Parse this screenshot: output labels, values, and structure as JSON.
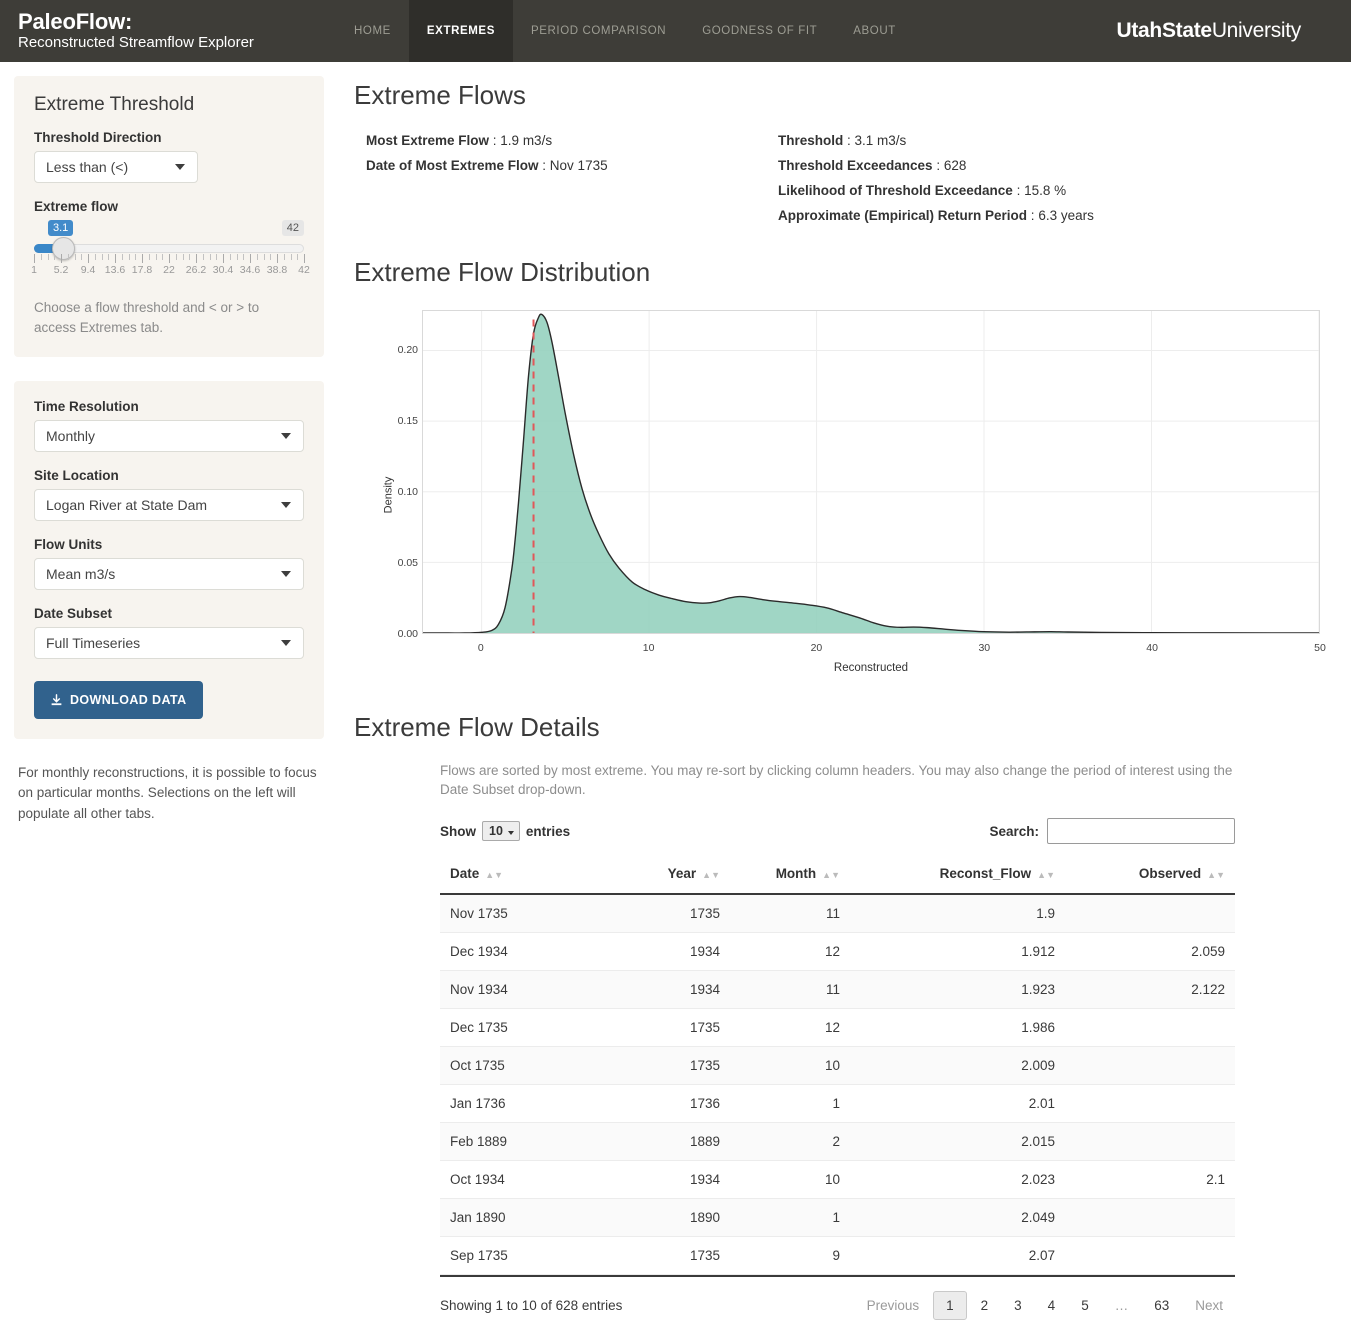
{
  "navbar": {
    "brand_title": "PaleoFlow:",
    "brand_subtitle": "Reconstructed Streamflow Explorer",
    "links": [
      {
        "label": "HOME",
        "active": false
      },
      {
        "label": "EXTREMES",
        "active": true
      },
      {
        "label": "PERIOD COMPARISON",
        "active": false
      },
      {
        "label": "GOODNESS OF FIT",
        "active": false
      },
      {
        "label": "ABOUT",
        "active": false
      }
    ],
    "org_bold": "UtahState",
    "org_light": "University",
    "bg_color": "#3e3d38",
    "active_bg_color": "#2f2e2a"
  },
  "sidebar": {
    "threshold_panel": {
      "title": "Extreme Threshold",
      "direction_label": "Threshold Direction",
      "direction_value": "Less than (<)",
      "slider_label": "Extreme flow",
      "slider_value": "3.1",
      "slider_max_label": "42",
      "slider_min": 1,
      "slider_max": 42,
      "tick_labels": [
        "1",
        "5.2",
        "9.4",
        "13.6",
        "17.8",
        "22",
        "26.2",
        "30.4",
        "34.6",
        "38.8",
        "42"
      ],
      "hint": "Choose a flow threshold and < or > to access Extremes tab.",
      "accent_color": "#3a87c8"
    },
    "controls_panel": {
      "time_resolution_label": "Time Resolution",
      "time_resolution_value": "Monthly",
      "site_location_label": "Site Location",
      "site_location_value": "Logan River at State Dam",
      "flow_units_label": "Flow Units",
      "flow_units_value": "Mean m3/s",
      "date_subset_label": "Date Subset",
      "date_subset_value": "Full Timeseries",
      "download_label": "DOWNLOAD DATA",
      "download_color": "#31628d"
    },
    "footnote": "For monthly reconstructions, it is possible to focus on particular months. Selections on the left will populate all other tabs."
  },
  "main": {
    "title": "Extreme Flows",
    "stats_left": [
      {
        "label": "Most Extreme Flow",
        "value": "1.9 m3/s"
      },
      {
        "label": "Date of Most Extreme Flow",
        "value": "Nov 1735"
      }
    ],
    "stats_right": [
      {
        "label": "Threshold",
        "value": "3.1 m3/s"
      },
      {
        "label": "Threshold Exceedances",
        "value": "628"
      },
      {
        "label": "Likelihood of Threshold Exceedance",
        "value": "15.8 %"
      },
      {
        "label": "Approximate (Empirical) Return Period",
        "value": "6.3 years"
      }
    ],
    "chart_title": "Extreme Flow Distribution",
    "details_title": "Extreme Flow Details",
    "details_desc": "Flows are sorted by most extreme. You may re-sort by clicking column headers. You may also change the period of interest using the Date Subset drop-down.",
    "show_label": "Show",
    "show_value": "10",
    "entries_label": "entries",
    "search_label": "Search:",
    "search_value": "",
    "search_placeholder": "",
    "columns": [
      "Date",
      "Year",
      "Month",
      "Reconst_Flow",
      "Observed"
    ],
    "rows": [
      {
        "date": "Nov 1735",
        "year": "1735",
        "month": "11",
        "reconst": "1.9",
        "observed": ""
      },
      {
        "date": "Dec 1934",
        "year": "1934",
        "month": "12",
        "reconst": "1.912",
        "observed": "2.059"
      },
      {
        "date": "Nov 1934",
        "year": "1934",
        "month": "11",
        "reconst": "1.923",
        "observed": "2.122"
      },
      {
        "date": "Dec 1735",
        "year": "1735",
        "month": "12",
        "reconst": "1.986",
        "observed": ""
      },
      {
        "date": "Oct 1735",
        "year": "1735",
        "month": "10",
        "reconst": "2.009",
        "observed": ""
      },
      {
        "date": "Jan 1736",
        "year": "1736",
        "month": "1",
        "reconst": "2.01",
        "observed": ""
      },
      {
        "date": "Feb 1889",
        "year": "1889",
        "month": "2",
        "reconst": "2.015",
        "observed": ""
      },
      {
        "date": "Oct 1934",
        "year": "1934",
        "month": "10",
        "reconst": "2.023",
        "observed": "2.1"
      },
      {
        "date": "Jan 1890",
        "year": "1890",
        "month": "1",
        "reconst": "2.049",
        "observed": ""
      },
      {
        "date": "Sep 1735",
        "year": "1735",
        "month": "9",
        "reconst": "2.07",
        "observed": ""
      }
    ],
    "showing_text": "Showing 1 to 10 of 628 entries",
    "pager": [
      "Previous",
      "1",
      "2",
      "3",
      "4",
      "5",
      "…",
      "63",
      "Next"
    ],
    "pager_current": "1"
  },
  "chart_data": {
    "type": "area",
    "title": "Extreme Flow Distribution",
    "xlabel": "Reconstructed",
    "ylabel": "Density",
    "xlim": [
      -3.5,
      50
    ],
    "ylim": [
      0,
      0.228
    ],
    "xticks": [
      0,
      10,
      20,
      30,
      40,
      50
    ],
    "yticks": [
      0.0,
      0.05,
      0.1,
      0.15,
      0.2
    ],
    "ytick_labels": [
      "0.00",
      "0.05",
      "0.10",
      "0.15",
      "0.20"
    ],
    "grid": true,
    "legend": "none",
    "fill_color": "#8fcfbb",
    "line_color": "#2b2b2b",
    "threshold_line": {
      "x": 3.1,
      "color": "#e15759",
      "style": "dashed",
      "label": "3.1"
    },
    "x": [
      -3.5,
      -2.0,
      -1.0,
      0.0,
      0.6,
      1.0,
      1.4,
      1.8,
      2.0,
      2.2,
      2.5,
      2.8,
      3.1,
      3.4,
      3.6,
      3.9,
      4.2,
      4.6,
      5.0,
      5.5,
      6.0,
      6.5,
      7.0,
      7.6,
      8.2,
      9.0,
      9.8,
      10.6,
      11.4,
      12.2,
      13.0,
      13.6,
      14.2,
      14.8,
      15.4,
      16.0,
      16.8,
      17.6,
      18.6,
      19.6,
      20.6,
      21.6,
      22.6,
      23.4,
      24.2,
      25.0,
      25.8,
      26.6,
      27.6,
      28.6,
      30.0,
      31.5,
      33.0,
      34.0,
      35.0,
      37.0,
      40.0,
      44.0,
      47.5,
      50.0
    ],
    "y": [
      0.0,
      0.0,
      0.0,
      0.0005,
      0.0018,
      0.006,
      0.018,
      0.045,
      0.066,
      0.092,
      0.136,
      0.182,
      0.212,
      0.2235,
      0.2255,
      0.22,
      0.206,
      0.181,
      0.155,
      0.126,
      0.102,
      0.084,
      0.07,
      0.056,
      0.046,
      0.036,
      0.0305,
      0.0268,
      0.0243,
      0.0222,
      0.0212,
      0.0214,
      0.0228,
      0.0248,
      0.0258,
      0.0252,
      0.0236,
      0.0224,
      0.0212,
      0.0198,
      0.0178,
      0.0142,
      0.0106,
      0.0072,
      0.0048,
      0.004,
      0.0042,
      0.0038,
      0.0028,
      0.0018,
      0.0009,
      0.0006,
      0.0008,
      0.0009,
      0.0007,
      0.0004,
      0.0002,
      8e-05,
      0.0,
      0.0
    ]
  }
}
